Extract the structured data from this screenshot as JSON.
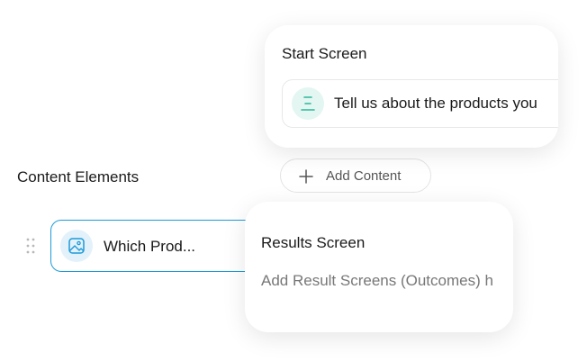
{
  "start_screen": {
    "title": "Start Screen",
    "item_text": "Tell us about the products you",
    "item_icon": "text-align-icon",
    "accent_color": "#2bb79a"
  },
  "add_content": {
    "label": "Add Content",
    "icon": "plus-icon"
  },
  "content_elements": {
    "heading": "Content Elements",
    "items": [
      {
        "label": "Which Prod...",
        "icon": "image-icon",
        "accent_color": "#1e9bd7"
      }
    ]
  },
  "results_screen": {
    "title": "Results Screen",
    "text": "Add Result Screens (Outcomes) h"
  }
}
